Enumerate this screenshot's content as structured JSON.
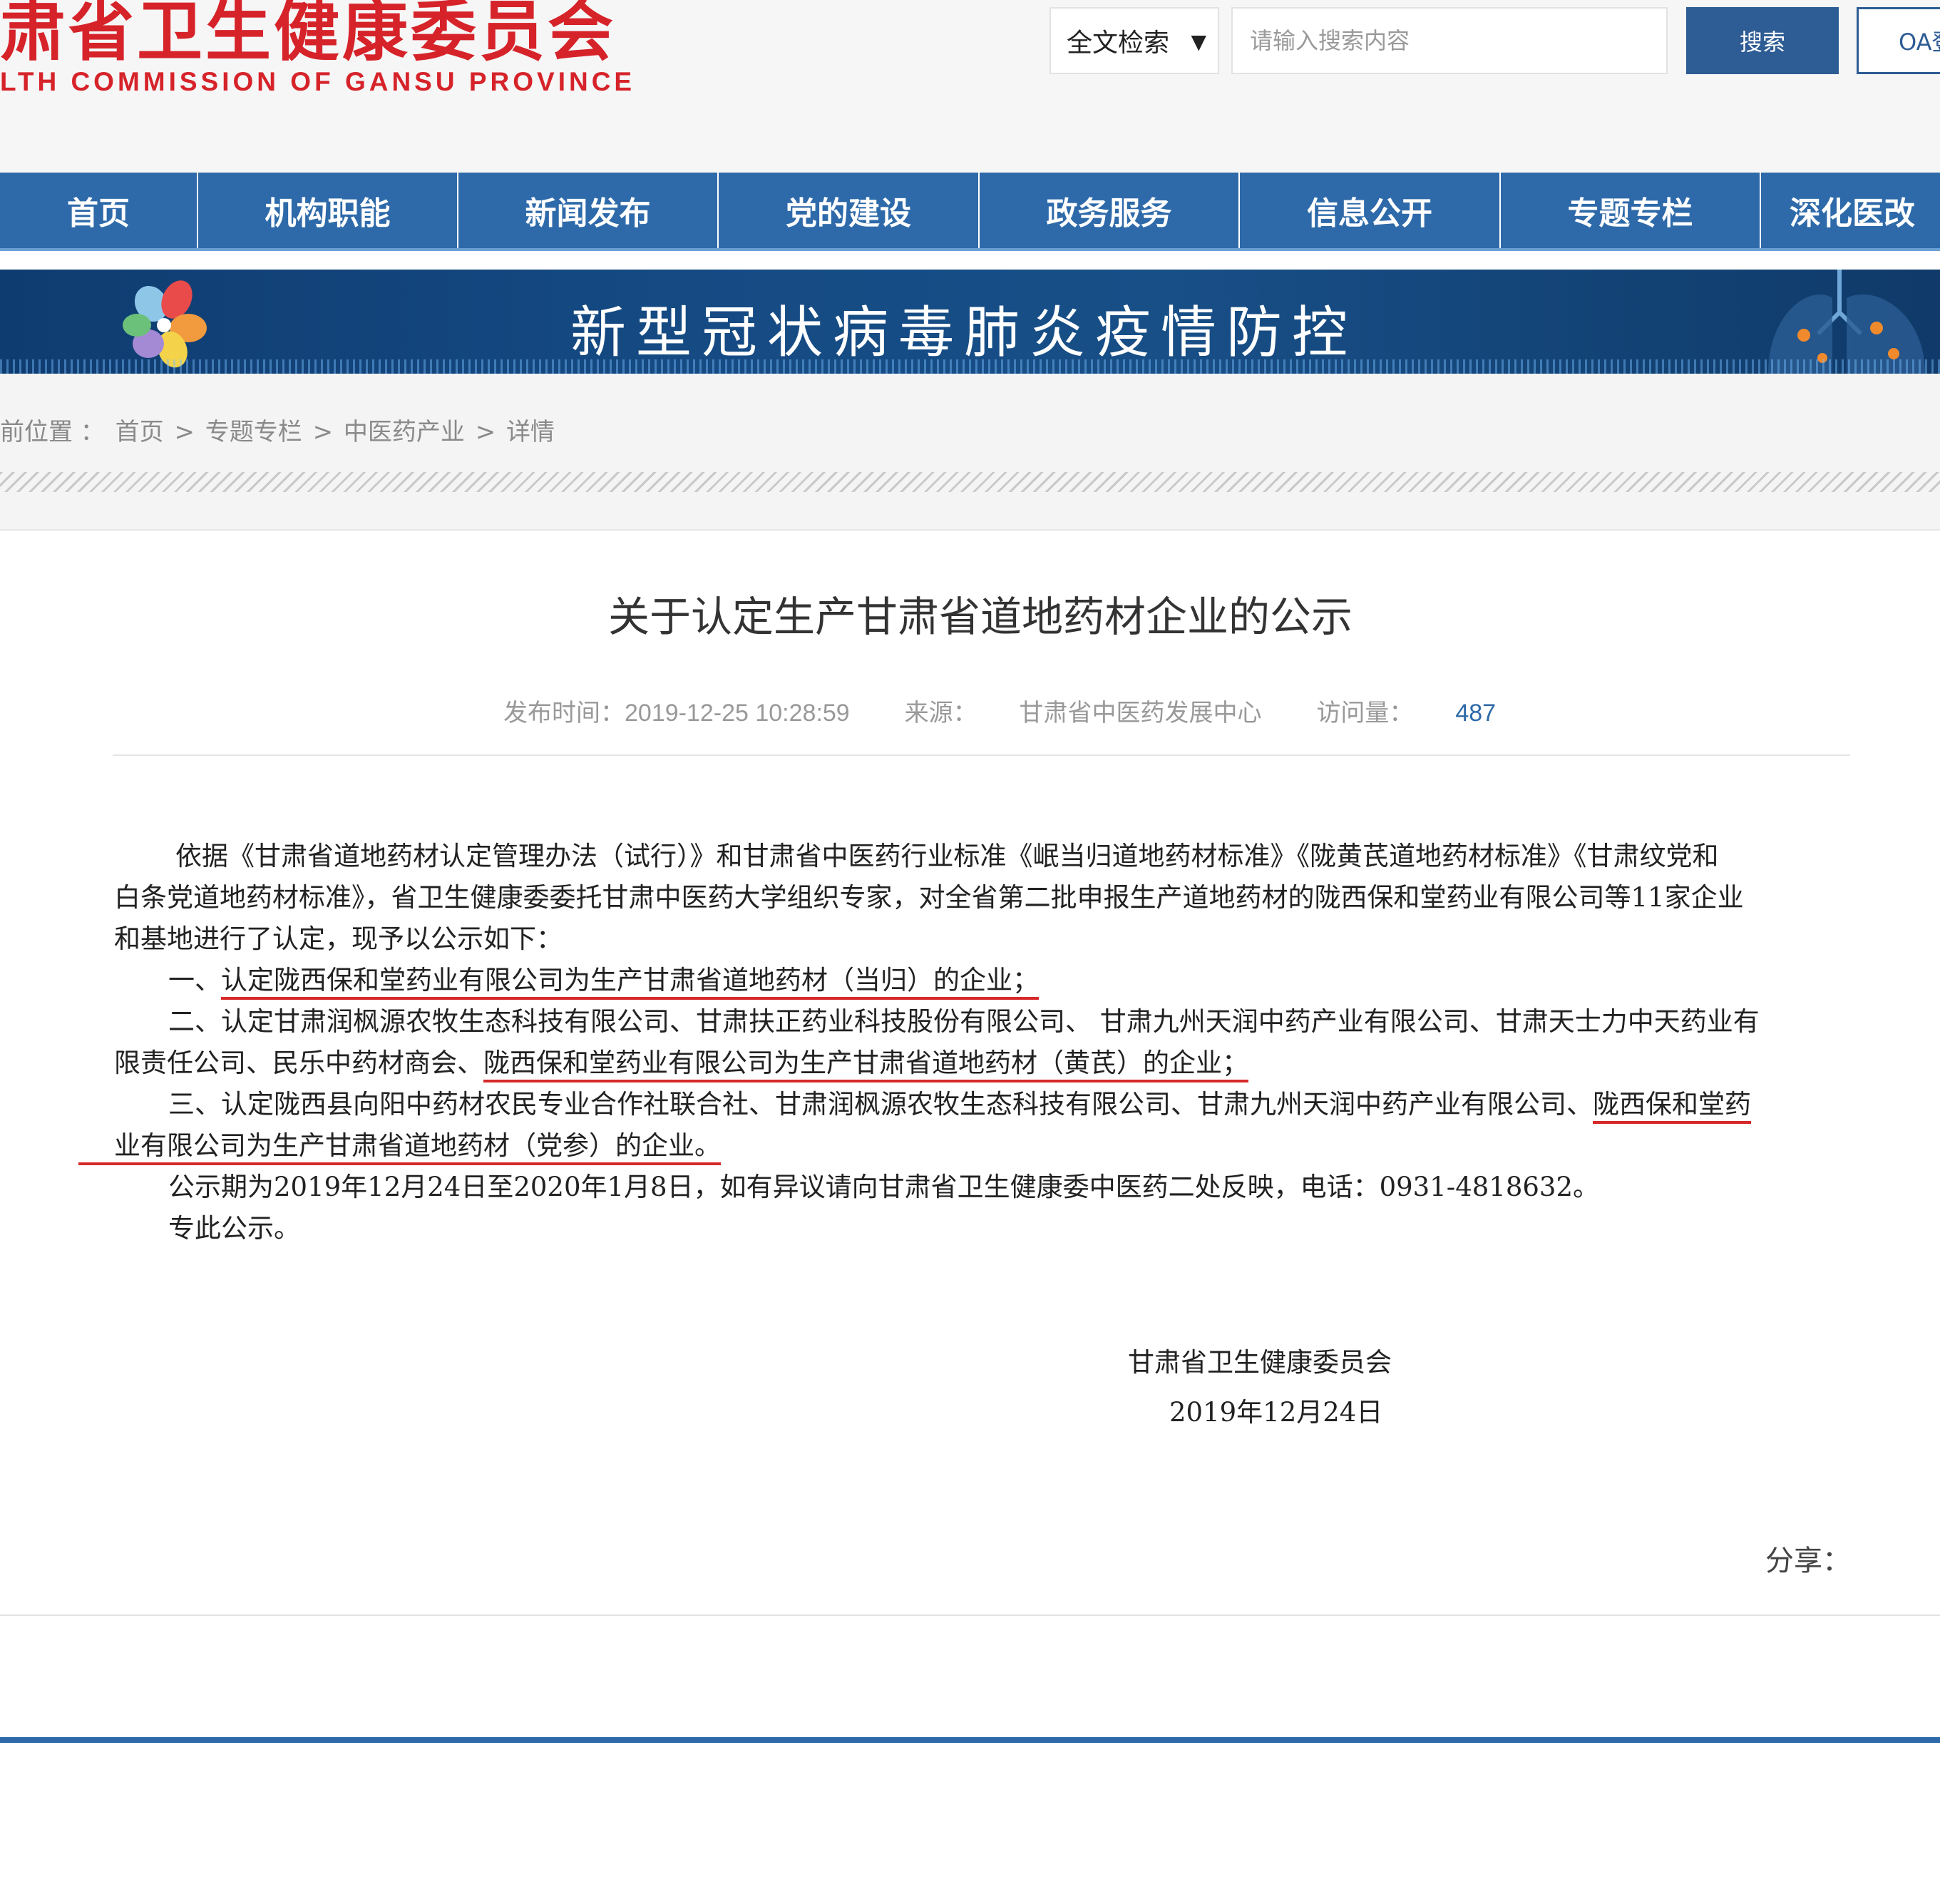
{
  "header": {
    "logo_cn": "肃省卫生健康委员会",
    "logo_en": "LTH COMMISSION OF GANSU PROVINCE",
    "search_scope": "全文检索",
    "search_placeholder": "请输入搜索内容",
    "search_button": "搜索",
    "oa_button": "OA登"
  },
  "nav": {
    "items": [
      "首页",
      "机构职能",
      "新闻发布",
      "党的建设",
      "政务服务",
      "信息公开",
      "专题专栏",
      "深化医改"
    ]
  },
  "banner": {
    "title": "新型冠状病毒肺炎疫情防控"
  },
  "breadcrumb": {
    "label": "前位置 ：",
    "items": [
      "首页",
      "专题专栏",
      "中医药产业",
      "详情"
    ],
    "separator": ">"
  },
  "article": {
    "title": "关于认定生产甘肃省道地药材企业的公示",
    "meta": {
      "time_label": "发布时间：",
      "time_value": "2019-12-25 10:28:59",
      "source_label": "来源：",
      "source_value": "甘肃省中医药发展中心",
      "views_label": "访问量：",
      "views_value": "487"
    },
    "para1": [
      "依据《甘肃省道地药材认定管理办法（试行）》和甘肃省中医药行业标准《岷当归道地药材标准》《陇黄芪道地药材标准》《甘肃纹党和",
      "白条党道地药材标准》，省卫生健康委委托甘肃中医药大学组织专家，对全省第二批申报生产道地药材的陇西保和堂药业有限公司等11家企业",
      "和基地进行了认定，现予以公示如下："
    ],
    "item1_prefix": "一、",
    "item1_underlined": "认定陇西保和堂药业有限公司为生产甘肃省道地药材（当归）的企业；",
    "item2_line1": "二、认定甘肃润枫源农牧生态科技有限公司、甘肃扶正药业科技股份有限公司、 甘肃九州天润中药产业有限公司、甘肃天士力中天药业有",
    "item2_line2_plain": "限责任公司、民乐中药材商会、",
    "item2_line2_underlined": "陇西保和堂药业有限公司为生产甘肃省道地药材（黄芪）的企业；",
    "item3_line1_plain": "三、认定陇西县向阳中药材农民专业合作社联合社、甘肃润枫源农牧生态科技有限公司、甘肃九州天润中药产业有限公司、",
    "item3_line1_underlined": "陇西保和堂药",
    "item3_line2_underlined": "业有限公司为生产甘肃省道地药材（党参）的企业。",
    "period": "公示期为2019年12月24日至2020年1月8日，如有异议请向甘肃省卫生健康委中医药二处反映，电话：0931-4818632。",
    "closing": "专此公示。",
    "signature_org": "甘肃省卫生健康委员会",
    "signature_date": "2019年12月24日"
  },
  "share": {
    "label": "分享："
  },
  "colors": {
    "nav_blue": "#2e6aa9",
    "button_blue": "#2e5c94",
    "logo_red": "#d6232a",
    "underline_red": "#d62a2a",
    "views_blue": "#2e6aa9"
  }
}
